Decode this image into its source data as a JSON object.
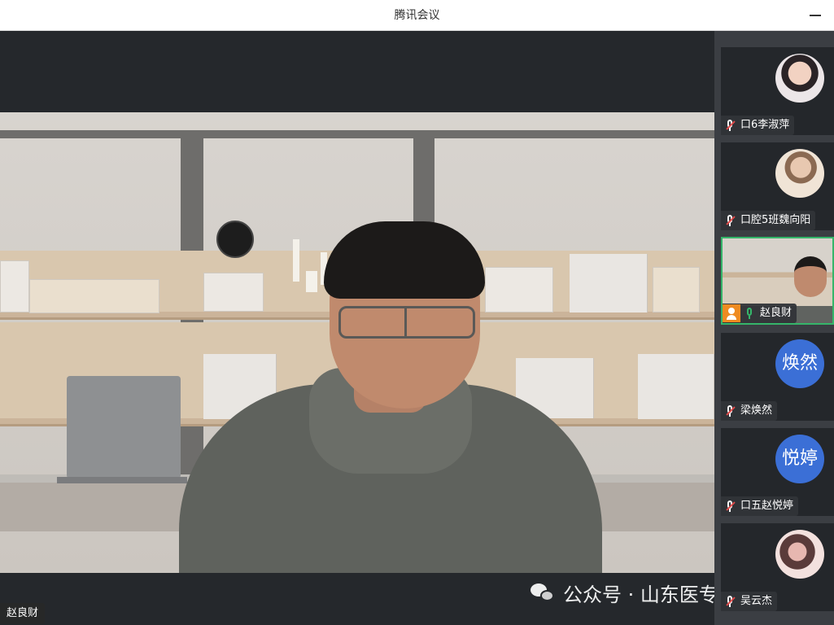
{
  "window": {
    "title": "腾讯会议"
  },
  "main_video": {
    "name": "赵良财"
  },
  "watermark": {
    "text": "公众号 · 山东医专团委",
    "icon": "wechat-icon"
  },
  "participants": [
    {
      "name": "口6李淑萍",
      "mic": "muted",
      "avatar_type": "photo"
    },
    {
      "name": "口腔5班魏向阳",
      "mic": "muted",
      "avatar_type": "photo"
    },
    {
      "name": "赵良财",
      "mic": "on",
      "host": true,
      "avatar_type": "video"
    },
    {
      "name": "梁焕然",
      "mic": "muted",
      "avatar_type": "text",
      "avatar_text": "焕然"
    },
    {
      "name": "口五赵悦婷",
      "mic": "muted",
      "avatar_type": "text",
      "avatar_text": "悦婷"
    },
    {
      "name": "吴云杰",
      "mic": "muted",
      "avatar_type": "photo"
    }
  ],
  "colors": {
    "sidebar_bg": "#3b3e43",
    "active_border": "#35b56a",
    "text_avatar_bg": "#3b6fd6",
    "host_badge": "#ef8b20",
    "muted_slash": "#e24b4b"
  }
}
